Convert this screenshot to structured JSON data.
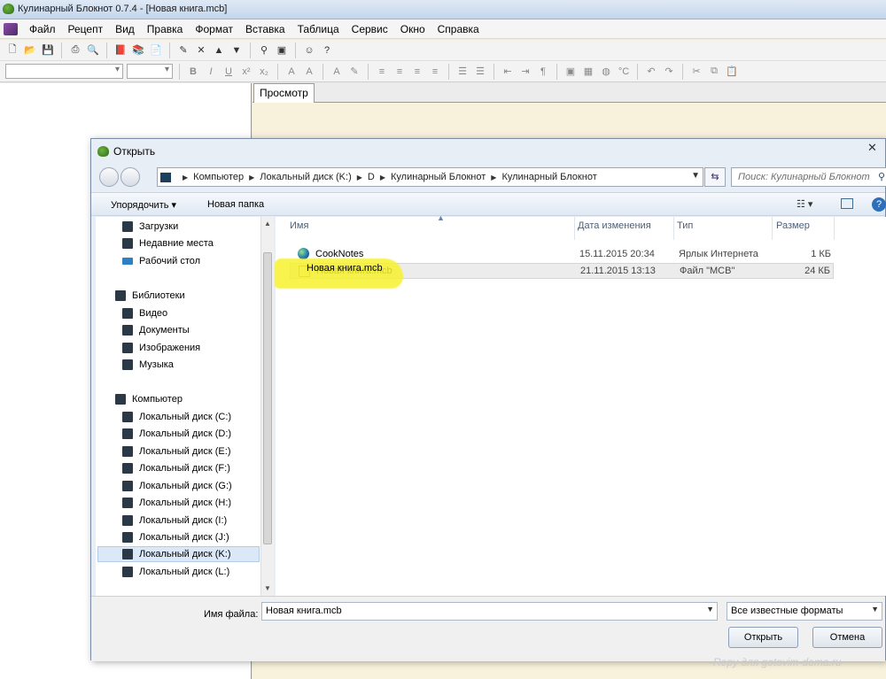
{
  "app": {
    "title": "Кулинарный Блокнот 0.7.4 - [Новая книга.mcb]"
  },
  "menu": [
    "Файл",
    "Рецепт",
    "Вид",
    "Правка",
    "Формат",
    "Вставка",
    "Таблица",
    "Сервис",
    "Окно",
    "Справка"
  ],
  "tabs": {
    "preview": "Просмотр"
  },
  "dialog": {
    "title": "Открыть",
    "breadcrumb": [
      "Компьютер",
      "Локальный диск (K:)",
      "D",
      "Кулинарный Блокнот",
      "Кулинарный Блокнот"
    ],
    "search_placeholder": "Поиск: Кулинарный Блокнот",
    "organize": "Упорядочить",
    "new_folder": "Новая папка",
    "columns": {
      "name": "Имя",
      "date": "Дата изменения",
      "type": "Тип",
      "size": "Размер"
    },
    "files": [
      {
        "name": "CookNotes",
        "date": "15.11.2015 20:34",
        "type": "Ярлык Интернета",
        "size": "1 КБ"
      },
      {
        "name": "Новая книга.mcb",
        "date": "21.11.2015 13:13",
        "type": "Файл \"MCB\"",
        "size": "24 КБ"
      }
    ],
    "nav": {
      "favorites": [
        "Загрузки",
        "Недавние места",
        "Рабочий стол"
      ],
      "libraries_label": "Библиотеки",
      "libraries": [
        "Видео",
        "Документы",
        "Изображения",
        "Музыка"
      ],
      "computer_label": "Компьютер",
      "drives": [
        "Локальный диск (C:)",
        "Локальный диск (D:)",
        "Локальный диск (E:)",
        "Локальный диск (F:)",
        "Локальный диск (G:)",
        "Локальный диск (H:)",
        "Локальный диск (I:)",
        "Локальный диск (J:)",
        "Локальный диск (K:)",
        "Локальный диск (L:)"
      ]
    },
    "filename_label": "Имя файла:",
    "filename_value": "Новая книга.mcb",
    "filter_value": "Все известные форматы",
    "open_button": "Открыть",
    "cancel_button": "Отмена"
  },
  "watermark": "Repy для gotovim-doma.ru"
}
